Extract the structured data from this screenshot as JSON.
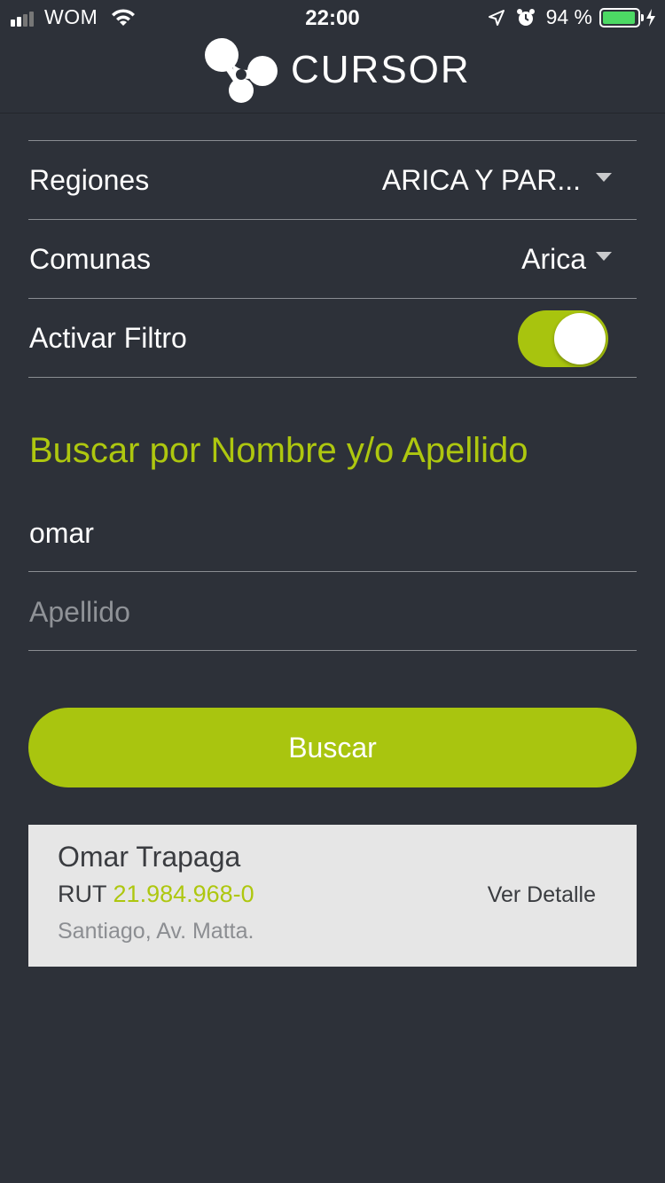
{
  "status_bar": {
    "carrier": "WOM",
    "time": "22:00",
    "battery_percent": "94 %",
    "battery_level": 0.94,
    "icons": [
      "signal-icon",
      "wifi-icon",
      "location-arrow-icon",
      "alarm-icon",
      "battery-icon",
      "charging-bolt-icon"
    ]
  },
  "header": {
    "logo_text": "CURSOR"
  },
  "filters": {
    "region_label": "Regiones",
    "region_value": "ARICA Y PAR...",
    "commune_label": "Comunas",
    "commune_value": "Arica",
    "filter_label": "Activar Filtro",
    "filter_enabled": true
  },
  "search": {
    "title": "Buscar por Nombre y/o Apellido",
    "name_value": "omar",
    "lastname_placeholder": "Apellido",
    "button_label": "Buscar"
  },
  "results": [
    {
      "name": "Omar Trapaga",
      "rut_label": "RUT",
      "rut_value": "21.984.968-0",
      "address": "Santiago, Av. Matta.",
      "detail_label": "Ver Detalle"
    }
  ],
  "colors": {
    "background": "#2d3139",
    "accent": "#a9c50f",
    "card": "#e6e6e6",
    "battery": "#4cd964"
  }
}
